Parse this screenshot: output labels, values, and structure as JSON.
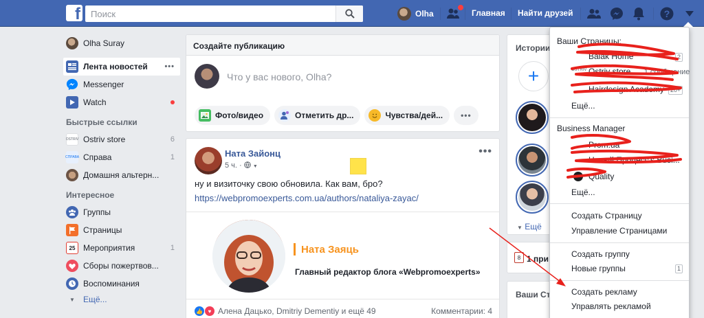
{
  "topbar": {
    "logo": "f",
    "search_placeholder": "Поиск",
    "user_name": "Olha",
    "home": "Главная",
    "find_friends": "Найти друзей"
  },
  "leftnav": {
    "profile": "Olha Suray",
    "main": [
      {
        "label": "Лента новостей",
        "active": true
      },
      {
        "label": "Messenger"
      },
      {
        "label": "Watch"
      }
    ],
    "quick_links_title": "Быстрые ссылки",
    "quick_links": [
      {
        "label": "Ostriv store",
        "count": "6"
      },
      {
        "label": "Справа",
        "count": "1"
      },
      {
        "label": "Домашня альтерн..."
      }
    ],
    "interesting_title": "Интересное",
    "interesting": [
      {
        "label": "Группы"
      },
      {
        "label": "Страницы"
      },
      {
        "label": "Мероприятия",
        "count": "1"
      },
      {
        "label": "Сборы пожертвов..."
      },
      {
        "label": "Воспоминания"
      }
    ],
    "more": "Ещё..."
  },
  "composer": {
    "title": "Создайте публикацию",
    "placeholder": "Что у вас нового, Olha?",
    "actions": [
      "Фото/видео",
      "Отметить др...",
      "Чувства/дей..."
    ]
  },
  "post": {
    "author": "Ната Зайонц",
    "time": "5 ч. · ",
    "text": "ну и визиточку свою обновила. Как вам, бро?",
    "link": "https://webpromoexperts.com.ua/authors/nataliya-zayac/",
    "preview_name": "Ната Заяць",
    "preview_role": "Главный редактор блога «Webpromoexperts»",
    "reactions": "Алена Дацько, Dmitriy Dementiy и ещё 49",
    "comments": "Комментарии: 4"
  },
  "rightcol": {
    "stories_title": "Истории",
    "stories_more": "Ещё",
    "events_text": "1 при",
    "pages_title": "Ваши Ст"
  },
  "dropdown": {
    "pages_title": "Ваши Страницы:",
    "pages": [
      {
        "label": "Balak Home",
        "badge": "2"
      },
      {
        "label": "Ostriv store",
        "extra": "1 сообщение",
        "logo": "OSTRIV"
      },
      {
        "label": "Hairdesign Academy",
        "badge": "20+"
      }
    ],
    "pages_more": "Ещё...",
    "bm_title": "Business Manager",
    "bm": [
      {
        "label": "Prom.ua"
      },
      {
        "label": "Новый Процесс's Busi..."
      },
      {
        "label": "Quality"
      }
    ],
    "bm_more": "Ещё...",
    "create_page": "Создать Страницу",
    "manage_pages": "Управление Страницами",
    "create_group": "Создать группу",
    "new_groups": "Новые группы",
    "new_groups_count": "1",
    "create_ad": "Создать рекламу",
    "manage_ads": "Управлять рекламой"
  },
  "colors": {
    "brand_blue": "#4267b2",
    "link_blue": "#385898",
    "annotation_red": "#e8211c",
    "accent_orange": "#f7931e"
  }
}
